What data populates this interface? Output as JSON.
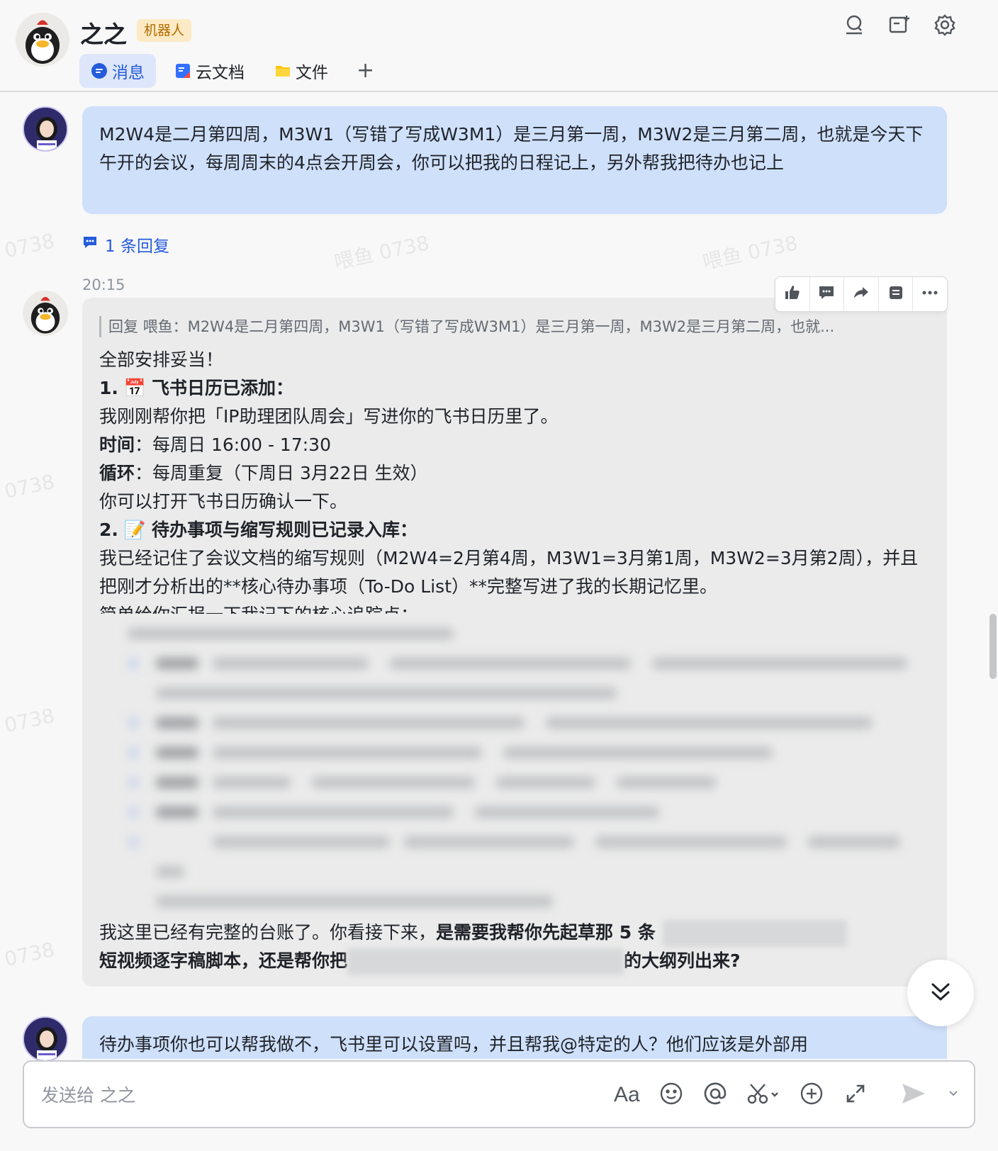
{
  "header": {
    "title": "之之",
    "badge": "机器人",
    "tabs": [
      {
        "label": "消息",
        "active": true
      },
      {
        "label": "云文档",
        "active": false
      },
      {
        "label": "文件",
        "active": false
      }
    ],
    "add_tab": "+"
  },
  "messages": {
    "user_first": "M2W4是二月第四周，M3W1（写错了写成W3M1）是三月第一周，M3W2是三月第二周，也就是今天下午开的会议，每周周末的4点会开周会，你可以把我的日程记上，另外帮我把待办也记上",
    "reply_count": "1 条回复",
    "timestamp": "20:15",
    "bot": {
      "quote": "回复 喂鱼：M2W4是二月第四周，M3W1（写错了写成W3M1）是三月第一周，M3W2是三月第二周，也就...",
      "line1": "全部安排妥当！",
      "h1_num": "1.",
      "h1_emoji": "📅",
      "h1_title": "飞书日历已添加：",
      "l2": "我刚刚帮你把「IP助理团队周会」写进你的飞书日历里了。",
      "time_label": "时间",
      "time_value": "：每周日 16:00 - 17:30",
      "loop_label": "循环",
      "loop_value": "：每周重复（下周日 3月22日 生效）",
      "l5": "你可以打开飞书日历确认一下。",
      "h2_num": "2.",
      "h2_emoji": "📝",
      "h2_title": "待办事项与缩写规则已记录入库：",
      "l7": "我已经记住了会议文档的缩写规则（M2W4=2月第4周，M3W1=3月第1周，M3W2=3月第2周），并且把刚才分析出的**核心待办事项（To-Do List）**完整写进了我的长期记忆里。",
      "l8": "简单给你汇报一下我记下的核心追踪点：",
      "tail_normal": "我这里已经有完整的台账了。你看接下来，",
      "tail_bold1": "是需要我帮你先起草那 5 条",
      "tail_bold2": "短视频逐字稿脚本，还是帮你把",
      "tail_bold3": "的大纲列出来?"
    },
    "user_second": "待办事项你也可以帮我做不，飞书里可以设置吗，并且帮我@特定的人？他们应该是外部用"
  },
  "composer": {
    "placeholder": "发送给 之之",
    "format_label": "Aa"
  },
  "watermark": "喂鱼 0738",
  "watermark_short": "0738",
  "colors": {
    "accent": "#245bdb",
    "user_bubble": "#cfe0fb",
    "bot_bubble": "#ebebeb",
    "badge_bg": "#fbeac4",
    "badge_text": "#b36b00"
  },
  "icons": [
    "search-icon",
    "new-chat-icon",
    "settings-icon",
    "message-tab-icon",
    "doc-tab-icon",
    "folder-tab-icon",
    "thread-icon",
    "thumbs-up-icon",
    "comment-icon",
    "forward-icon",
    "pin-icon",
    "more-icon",
    "chevrons-down-icon",
    "emoji-icon",
    "at-icon",
    "scissors-icon",
    "add-icon",
    "expand-icon",
    "send-icon"
  ]
}
